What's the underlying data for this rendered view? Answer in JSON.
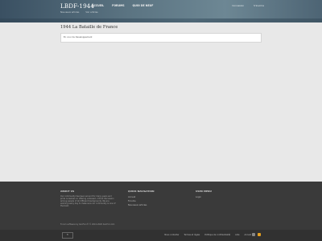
{
  "header": {
    "logo": "LBDF-1944",
    "nav": [
      "ACCUEIL",
      "FORUMS",
      "QUOI DE NEUF"
    ],
    "subnav": [
      "Nouveaux articles",
      "Voir articles"
    ],
    "right_links": [
      "Connexion",
      "S'inscrire"
    ]
  },
  "main": {
    "title": "1944 La Bataille de France",
    "box_text": "En cour de Developpement"
  },
  "footer": {
    "about": {
      "heading": "ABOUT US",
      "text": "Our community has been around for many years and pride ourselves on offering unbiased, critical discussion among people of all different backgrounds. We are working every day to make sure our community is one of the best."
    },
    "quick_nav": {
      "heading": "QUICK NAVIGATION",
      "links": [
        "Accueil",
        "Forums",
        "Nouveaux articles"
      ]
    },
    "user_menu": {
      "heading": "USER MENU",
      "links": [
        "Login"
      ]
    },
    "copyright": "Forum software by XenForo® © 2010-2020 XenForo Ltd.",
    "lang": "fr",
    "bottom_links": [
      "Nous contacter",
      "Termes et règles",
      "Politique de confidentialité",
      "Aide",
      "Accueil"
    ]
  }
}
